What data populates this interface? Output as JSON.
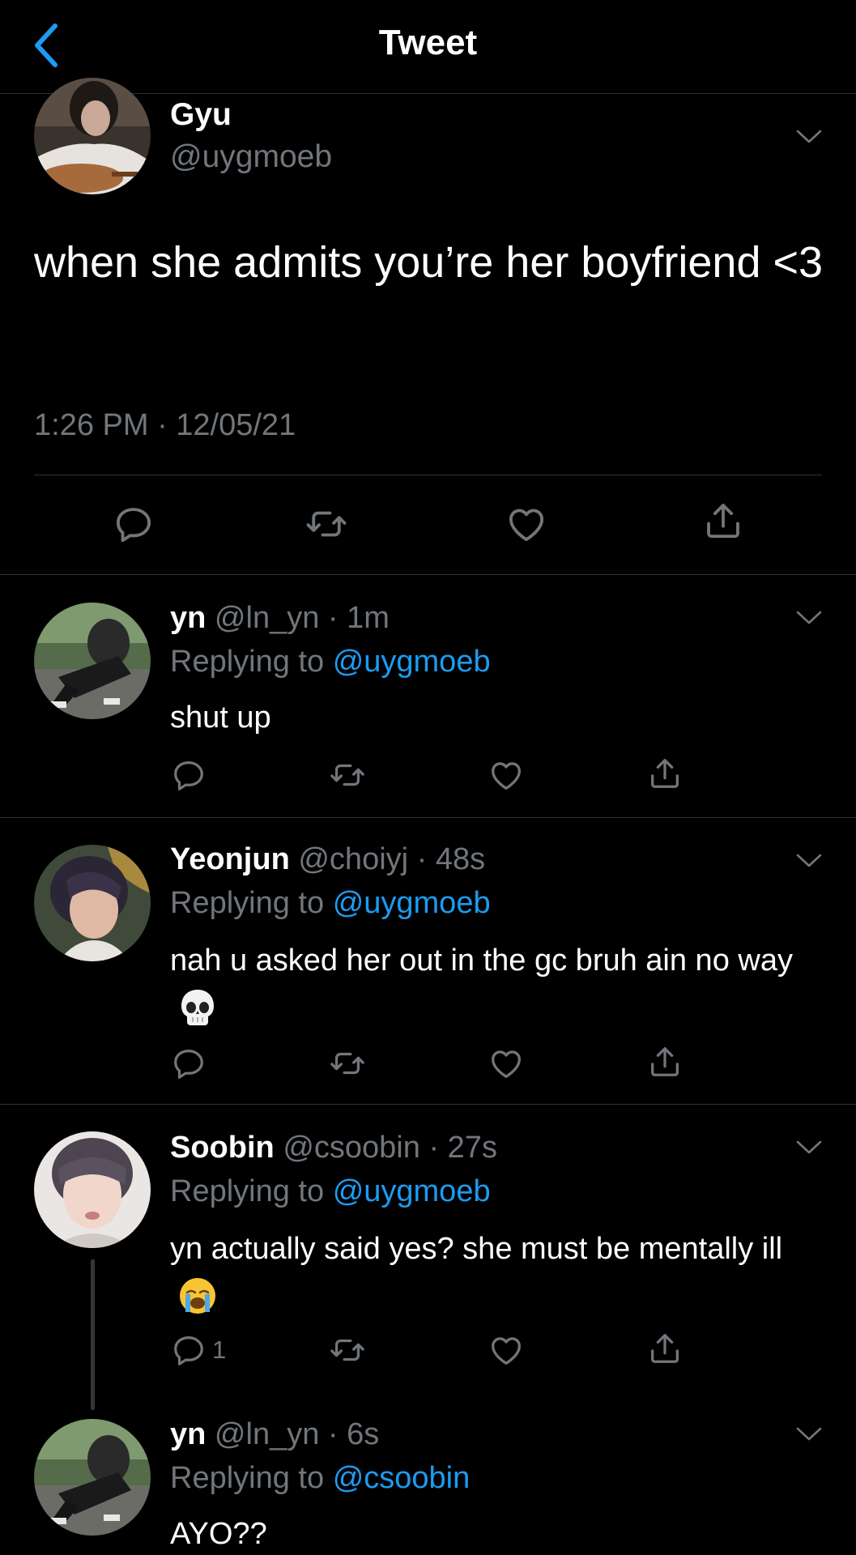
{
  "header": {
    "title": "Tweet"
  },
  "main_tweet": {
    "name": "Gyu",
    "handle": "@uygmoeb",
    "text": "when she admits you’re her boyfriend <3",
    "timestamp": "1:26 PM · 12/05/21"
  },
  "replies": [
    {
      "name": "yn",
      "handle": "@ln_yn",
      "time": "1m",
      "replying_prefix": "Replying to",
      "replying_to": "@uygmoeb",
      "text": "shut up",
      "reply_count": ""
    },
    {
      "name": "Yeonjun",
      "handle": "@choiyj",
      "time": "48s",
      "replying_prefix": "Replying to",
      "replying_to": "@uygmoeb",
      "text": "nah u asked her out in the gc bruh ain no way",
      "emoji": "skull-emoji",
      "reply_count": ""
    },
    {
      "name": "Soobin",
      "handle": "@csoobin",
      "time": "27s",
      "replying_prefix": "Replying to",
      "replying_to": "@uygmoeb",
      "text": "yn actually said yes? she must be mentally ill",
      "emoji": "loudly-crying-emoji",
      "reply_count": "1"
    },
    {
      "name": "yn",
      "handle": "@ln_yn",
      "time": "6s",
      "replying_prefix": "Replying to",
      "replying_to": "@csoobin",
      "text": "AYO??",
      "reply_count": ""
    }
  ],
  "colors": {
    "background": "#000000",
    "muted": "#71767b",
    "accent": "#1d9bf0",
    "divider": "#2f3336"
  },
  "icons": [
    "back-chevron-icon",
    "chevron-down-icon",
    "reply-icon",
    "retweet-icon",
    "like-icon",
    "share-icon"
  ]
}
